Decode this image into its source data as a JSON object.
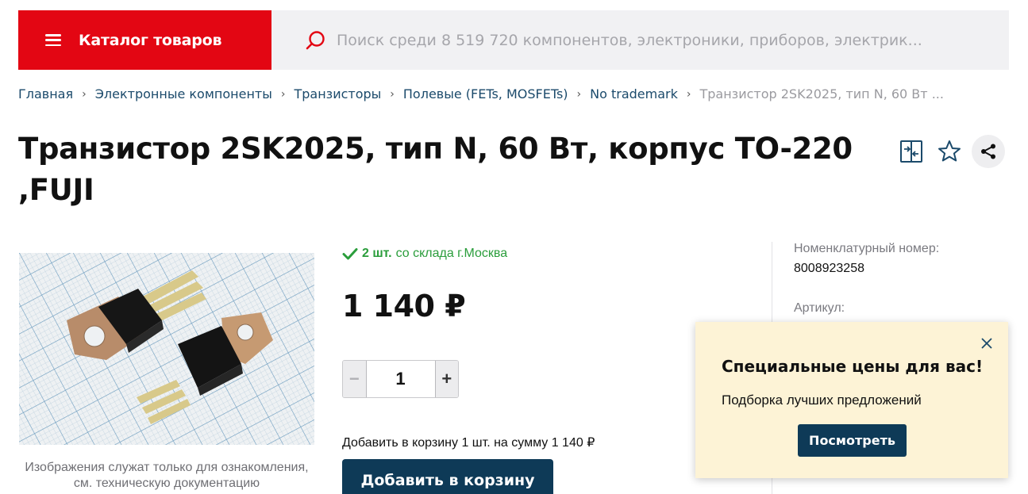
{
  "header": {
    "catalog_label": "Каталог товаров",
    "search_placeholder": "Поиск среди 8 519 720 компонентов, электроники, приборов, электрик...",
    "brand_color": "#e30613"
  },
  "breadcrumb": {
    "items": [
      "Главная",
      "Электронные компоненты",
      "Транзисторы",
      "Полевые (FETs, MOSFETs)",
      "No trademark"
    ],
    "separator": "›",
    "current": "Транзистор 2SK2025, тип N, 60 Вт ..."
  },
  "product": {
    "title": "Транзистор 2SK2025, тип N, 60 Вт, корпус TO-220 ,FUJI",
    "image_caption": "Изображения служат только для ознакомления, см. техническую документацию",
    "stock_qty": "2 шт.",
    "stock_text": "со склада г.Москва",
    "price": "1 140 ₽",
    "quantity": "1",
    "cart_summary": "Добавить в корзину 1 шт. на сумму 1 140 ₽",
    "add_to_cart_label": "Добавить в корзину"
  },
  "specs": [
    {
      "label": "Номенклатурный номер:",
      "value": "8008923258"
    },
    {
      "label": "Артикул:",
      "value": ""
    }
  ],
  "actions": {
    "compare_icon": "compare-icon",
    "favorite_icon": "star-icon",
    "share_icon": "share-icon"
  },
  "popup": {
    "title": "Специальные цены для вас!",
    "text": "Подборка лучших предложений",
    "button_label": "Посмотреть",
    "background": "#fdf3d6",
    "button_color": "#0e3a57"
  },
  "colors": {
    "accent_dark": "#0e3a57",
    "stock_green": "#2a9d3b",
    "link": "#1b4a6b"
  }
}
